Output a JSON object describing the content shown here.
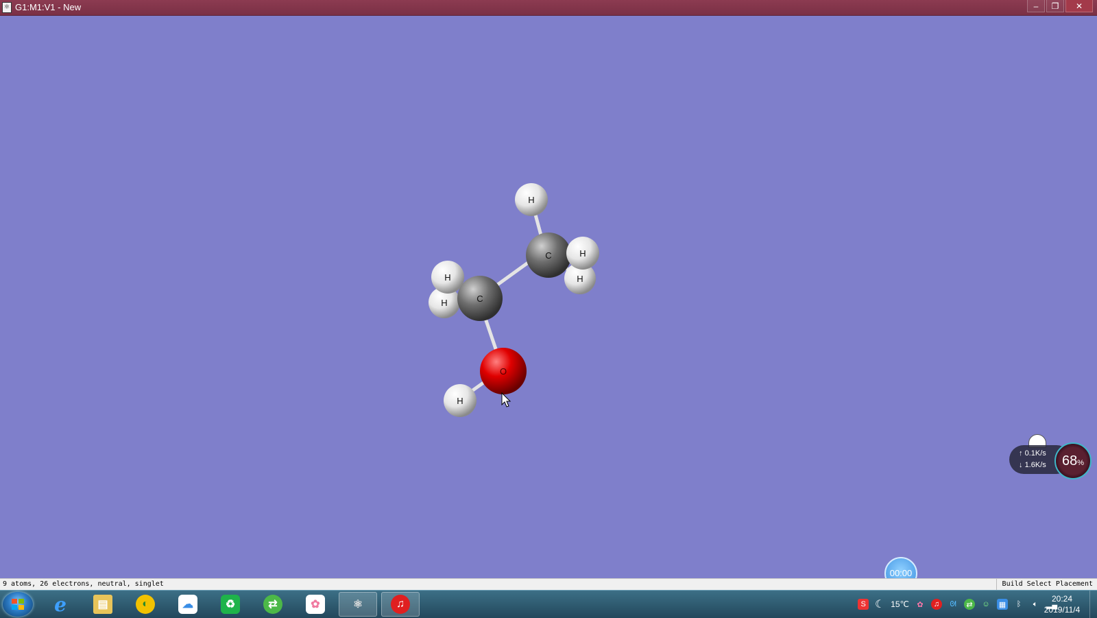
{
  "window": {
    "title": "G1:M1:V1 - New",
    "icon": "gaussview-doc-icon",
    "buttons": [
      "minimize",
      "restore",
      "close"
    ]
  },
  "viewport": {
    "background": "#7f7fcb",
    "molecule": {
      "atoms": [
        {
          "id": "h1",
          "element": "H"
        },
        {
          "id": "c2",
          "element": "C"
        },
        {
          "id": "h3",
          "element": "H"
        },
        {
          "id": "h4",
          "element": "H"
        },
        {
          "id": "h5",
          "element": "H"
        },
        {
          "id": "h6",
          "element": "H"
        },
        {
          "id": "c1",
          "element": "C"
        },
        {
          "id": "o1",
          "element": "O"
        },
        {
          "id": "h7",
          "element": "H"
        }
      ],
      "colors": {
        "C": "#6e6e6e",
        "H": "#f2f2f2",
        "O": "#e00000"
      }
    }
  },
  "status": {
    "left": "9 atoms, 26 electrons, neutral, singlet",
    "right": "Build Select Placement"
  },
  "overlay": {
    "timer": "00:00",
    "net_up": "0.1K/s",
    "net_down": "1.6K/s",
    "gauge": "68",
    "gauge_unit": "%"
  },
  "taskbar": {
    "apps": [
      {
        "name": "internet-explorer-icon",
        "color": "#1a7fd6"
      },
      {
        "name": "file-explorer-icon",
        "color": "#e8c45a"
      },
      {
        "name": "qq-browser-icon",
        "color": "#f2c200"
      },
      {
        "name": "baidu-netdisk-icon",
        "color": "#3a8ee6"
      },
      {
        "name": "recycle-app-icon",
        "color": "#1eb34a"
      },
      {
        "name": "sync-app-icon",
        "color": "#4cb848"
      },
      {
        "name": "photo-app-icon",
        "color": "#f07aa0"
      },
      {
        "name": "gaussview-icon",
        "color": "#9a9a9a"
      },
      {
        "name": "netease-music-icon",
        "color": "#e02020"
      }
    ],
    "tray": {
      "weather": "15℃",
      "time": "20:24",
      "date": "2019/11/4"
    }
  }
}
